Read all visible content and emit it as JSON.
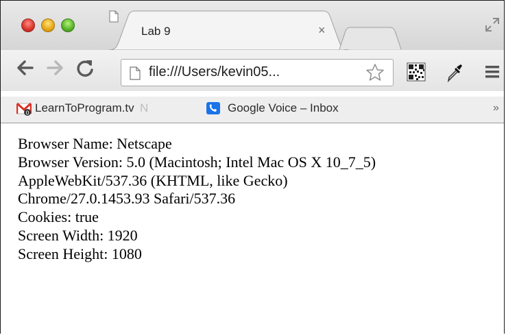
{
  "tab": {
    "title": "Lab 9",
    "close_glyph": "×"
  },
  "toolbar": {
    "url": "file:///Users/kevin05..."
  },
  "bookmarks": [
    {
      "label": "LearnToProgram.tv",
      "faded": "N",
      "icon": "gmail-icon"
    },
    {
      "label": "Google Voice – Inbox",
      "icon": "google-voice-icon"
    }
  ],
  "bookmarks_more": "»",
  "content": {
    "lines": [
      "Browser Name: Netscape",
      "Browser Version: 5.0 (Macintosh; Intel Mac OS X 10_7_5)",
      "AppleWebKit/537.36 (KHTML, like Gecko)",
      "Chrome/27.0.1453.93 Safari/537.36",
      "Cookies: true",
      "Screen Width: 1920",
      "Screen Height: 1080"
    ]
  },
  "colors": {
    "accent_blue": "#1a73e8",
    "gmail_red": "#d93025"
  }
}
